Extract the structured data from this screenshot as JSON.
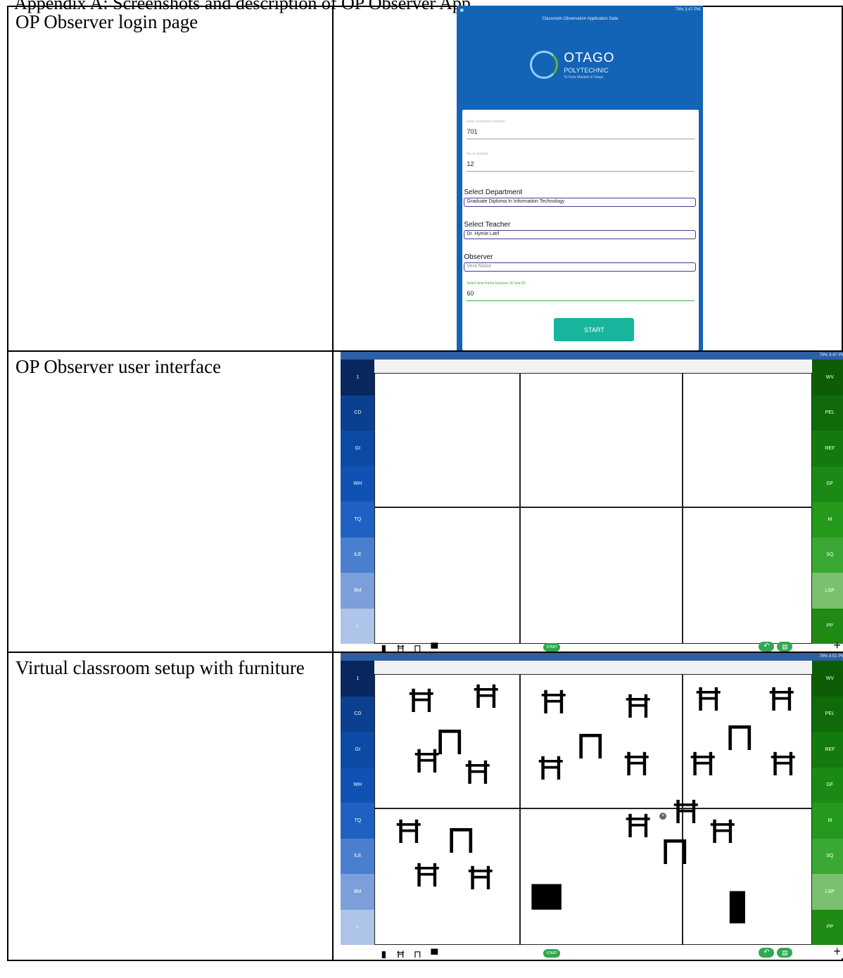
{
  "document": {
    "heading": "Appendix A: Screenshots and description of OP Observer App",
    "rows": [
      {
        "description": "OP Observer login page"
      },
      {
        "description": "OP Observer user interface"
      },
      {
        "description": "Virtual classroom setup with furniture"
      }
    ]
  },
  "login_screen": {
    "status_bar": "79% 3:47 PM",
    "app_title": "Classroom Observation Application Data",
    "logo": {
      "name": "OTAGO",
      "sub": "POLYTECHNIC",
      "tagline": "Te Kura Matatini ki Otago"
    },
    "fields": {
      "classroom": {
        "hint": "Enter classroom number",
        "value": "701"
      },
      "students": {
        "hint": "No of student",
        "value": "12"
      },
      "department": {
        "label": "Select Department",
        "value": "Graduate Diploma In Information Technology"
      },
      "teacher": {
        "label": "Select Teacher",
        "value": "Dr. Hymie Latif"
      },
      "observer": {
        "label": "Observer",
        "value": "Vera Nistor"
      },
      "timeframe": {
        "hint": "Select time-frame between 30 and 60",
        "value": "60"
      }
    },
    "start_label": "START"
  },
  "ui_screens": [
    {
      "status_bar": "79% 3:47 PM"
    },
    {
      "status_bar": "78% 3:51 PM"
    }
  ],
  "left_buttons": [
    "1",
    "CD",
    "GI",
    "WH",
    "TQ",
    "ILE",
    "BM",
    "L"
  ],
  "right_buttons": [
    "WV",
    "PEL",
    "REF",
    "GF",
    "M",
    "SQ",
    "LSP",
    "PP"
  ],
  "left_colors": [
    "#08275f",
    "#0b3f8f",
    "#0c4aa5",
    "#1052b3",
    "#1f61c2",
    "#4a7fcf",
    "#7c9edb",
    "#aec4e8"
  ],
  "right_colors": [
    "#0d5c06",
    "#0f6a0a",
    "#137a0d",
    "#1a8a14",
    "#24991c",
    "#3aa832",
    "#7bc06f",
    "#1f8a14"
  ],
  "bottom_start": "START",
  "plus": "+",
  "icons": {
    "door": "door-icon",
    "chair": "chair-icon",
    "table": "table-icon",
    "board": "board-icon",
    "undo": "undo-icon",
    "copy": "copy-icon",
    "close": "close-icon"
  }
}
